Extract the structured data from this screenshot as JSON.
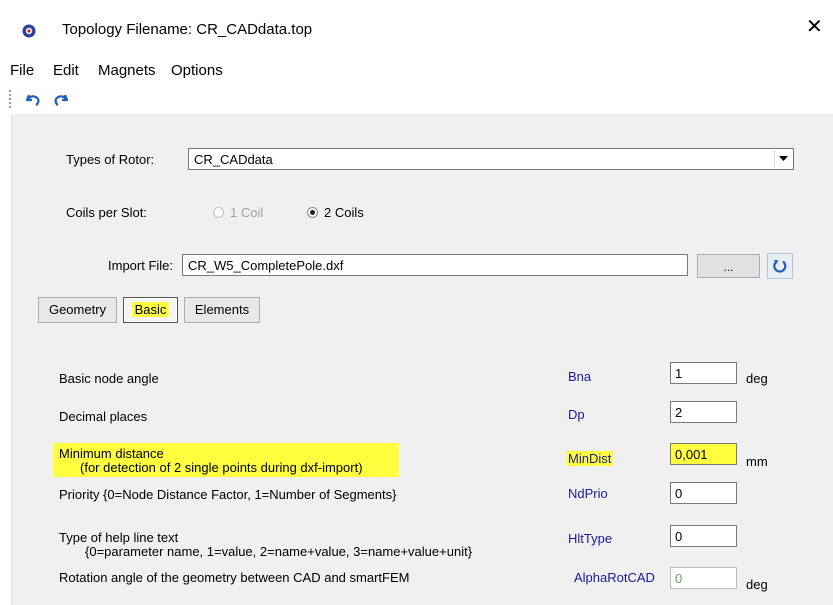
{
  "window": {
    "title": "Topology Filename: CR_CADdata.top",
    "close_glyph": "✕"
  },
  "menu": [
    "File",
    "Edit",
    "Magnets",
    "Options"
  ],
  "toolbar": {
    "icons": [
      "undo-icon",
      "redo-icon"
    ]
  },
  "rotor": {
    "label": "Types of Rotor:",
    "selected": "CR_CADdata"
  },
  "coils": {
    "label": "Coils per Slot:",
    "option1": "1 Coil",
    "option2": "2 Coils",
    "selected": "2 Coils"
  },
  "import": {
    "label": "Import File:",
    "value": "CR_W5_CompletePole.dxf",
    "browse": "..."
  },
  "tabs": [
    {
      "label": "Geometry",
      "active": false
    },
    {
      "label": "Basic",
      "active": true
    },
    {
      "label": "Elements",
      "active": false
    }
  ],
  "params": [
    {
      "desc": "Basic node angle",
      "desc2": "",
      "name": "Bna",
      "value": "1",
      "unit": "deg",
      "highlight": false,
      "enabled": true
    },
    {
      "desc": "Decimal places",
      "desc2": "",
      "name": "Dp",
      "value": "2",
      "unit": "",
      "highlight": false,
      "enabled": true
    },
    {
      "desc": "Minimum distance",
      "desc2": "(for detection of 2 single points during dxf-import)",
      "name": "MinDist",
      "value": "0,001",
      "unit": "mm",
      "highlight": true,
      "enabled": true
    },
    {
      "desc": "Priority {0=Node Distance Factor, 1=Number of Segments}",
      "desc2": "",
      "name": "NdPrio",
      "value": "0",
      "unit": "",
      "highlight": false,
      "enabled": true
    },
    {
      "desc": "Type of help line text",
      "desc2": "{0=parameter name, 1=value, 2=name+value, 3=name+value+unit}",
      "name": "HltType",
      "value": "0",
      "unit": "",
      "highlight": false,
      "enabled": true
    },
    {
      "desc": "Rotation angle of the geometry between CAD and smartFEM",
      "desc2": "",
      "name": "AlphaRotCAD",
      "value": "0",
      "unit": "deg",
      "highlight": false,
      "enabled": false
    }
  ],
  "colors": {
    "highlight": "#ffff40",
    "param_name": "#1a1a9a",
    "disabled_value": "#6aa06a"
  }
}
